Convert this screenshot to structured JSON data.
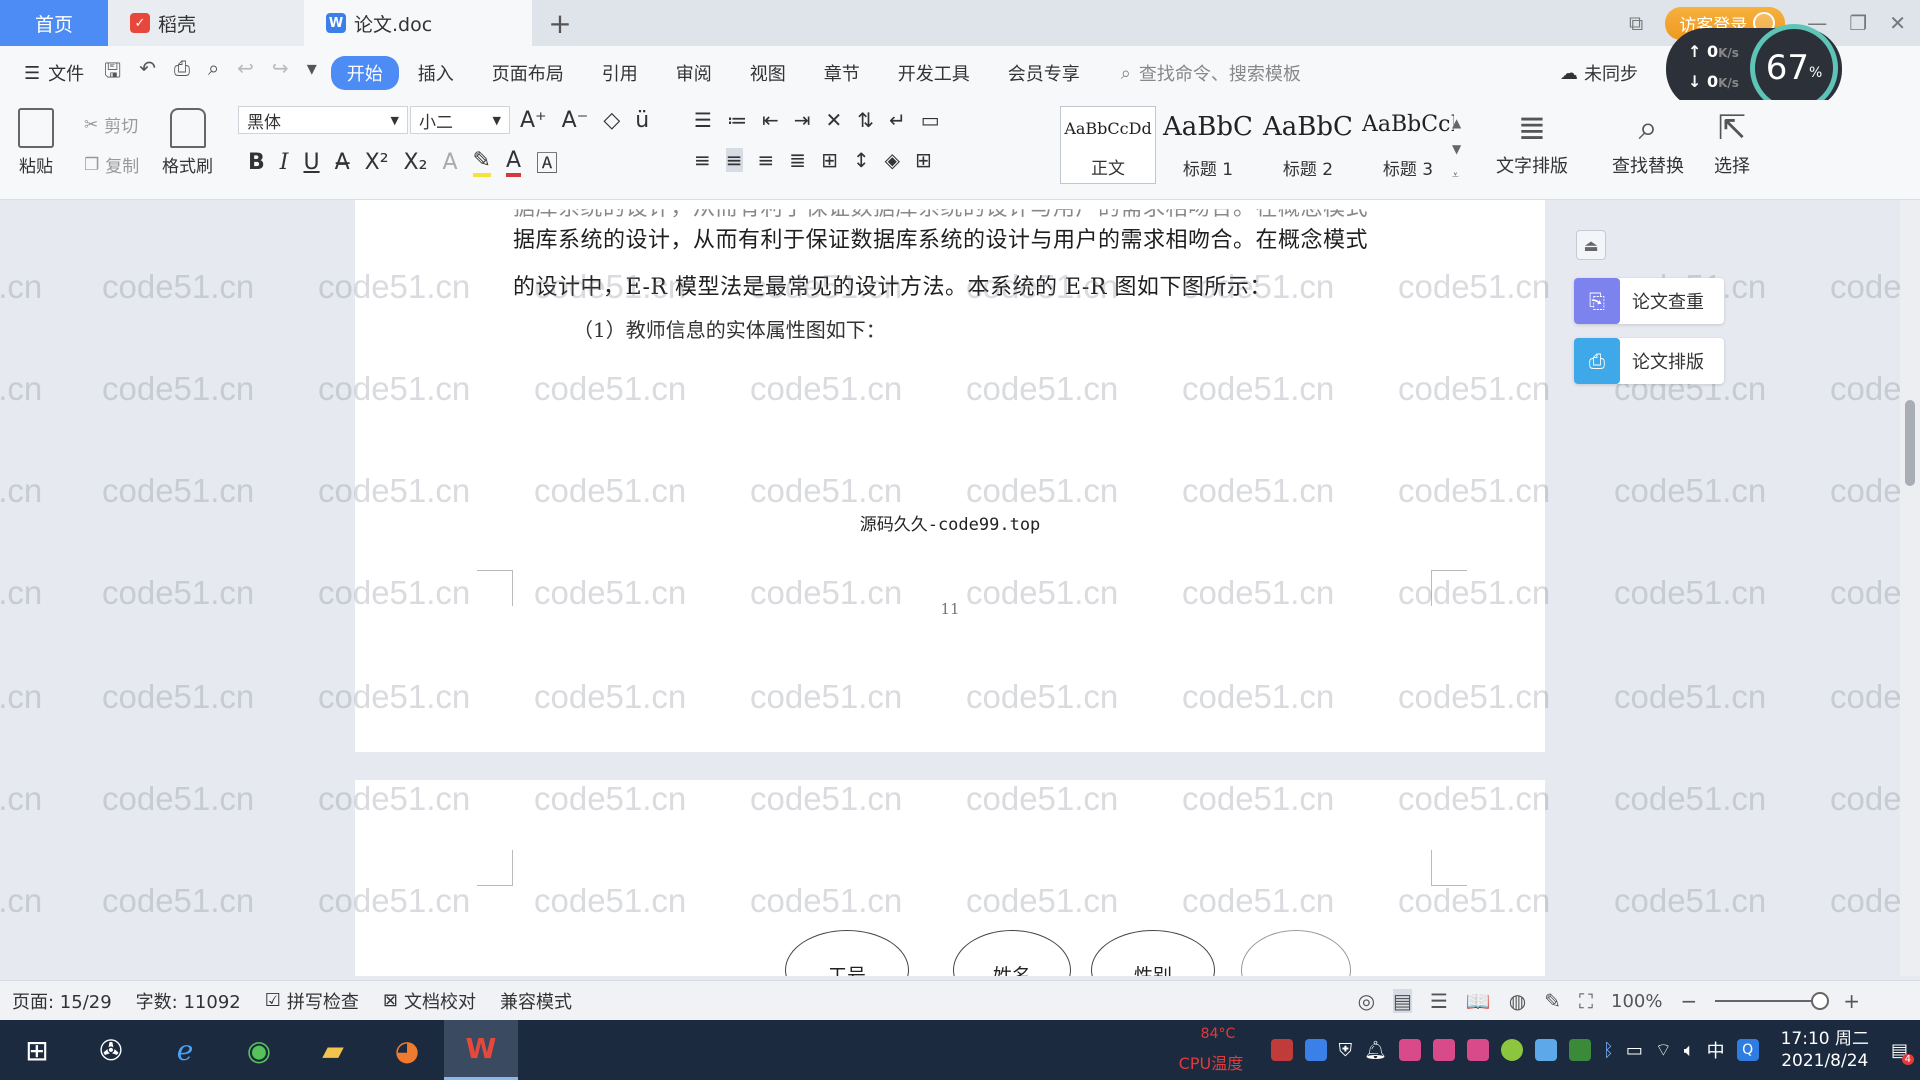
{
  "tabs": {
    "home": "首页",
    "daoke": "稻壳",
    "doc": "论文.doc",
    "add": "+"
  },
  "login": "访客登录",
  "menu": {
    "file": "文件",
    "items": [
      "开始",
      "插入",
      "页面布局",
      "引用",
      "审阅",
      "视图",
      "章节",
      "开发工具",
      "会员专享"
    ],
    "search_placeholder": "查找命令、搜索模板",
    "sync": "未同步"
  },
  "speed": {
    "up": "0",
    "down": "0",
    "unit": "K/s",
    "percent": "67",
    "percent_sign": "%"
  },
  "ribbon": {
    "paste": "粘贴",
    "cut": "剪切",
    "copy": "复制",
    "format_painter": "格式刷",
    "font_name": "黑体",
    "font_size": "小二",
    "styles": [
      {
        "sample": "AaBbCcDd",
        "name": "正文"
      },
      {
        "sample": "AaBbC",
        "name": "标题 1"
      },
      {
        "sample": "AaBbC",
        "name": "标题 2"
      },
      {
        "sample": "AaBbCcI",
        "name": "标题 3"
      }
    ],
    "text_layout": "文字排版",
    "find_replace": "查找替换",
    "select": "选择"
  },
  "document": {
    "line1": "据库系统的设计，从而有利于保证数据库系统的设计与用户的需求相吻合。在概念模式",
    "line2": "的设计中，E-R 模型法是最常见的设计方法。本系统的 E-R 图如下图所示：",
    "line3": "（1）教师信息的实体属性图如下：",
    "center_note": "源码久久-code99.top",
    "page_number": "11",
    "entities": [
      "工号",
      "姓名",
      "性别"
    ]
  },
  "watermark": "code51.cn",
  "side_panel": {
    "check": "论文查重",
    "layout": "论文排版"
  },
  "status": {
    "page": "页面: 15/29",
    "words": "字数: 11092",
    "spell": "拼写检查",
    "proof": "文档校对",
    "compat": "兼容模式",
    "zoom": "100%"
  },
  "taskbar": {
    "cpu_temp": "84°C",
    "cpu_label": "CPU温度",
    "ime": "中",
    "time": "17:10 周二",
    "date": "2021/8/24",
    "notification_count": "4"
  },
  "colors": {
    "accent": "#4d8cf5",
    "login": "#f0a02a",
    "taskbar": "#1b2a3e"
  }
}
